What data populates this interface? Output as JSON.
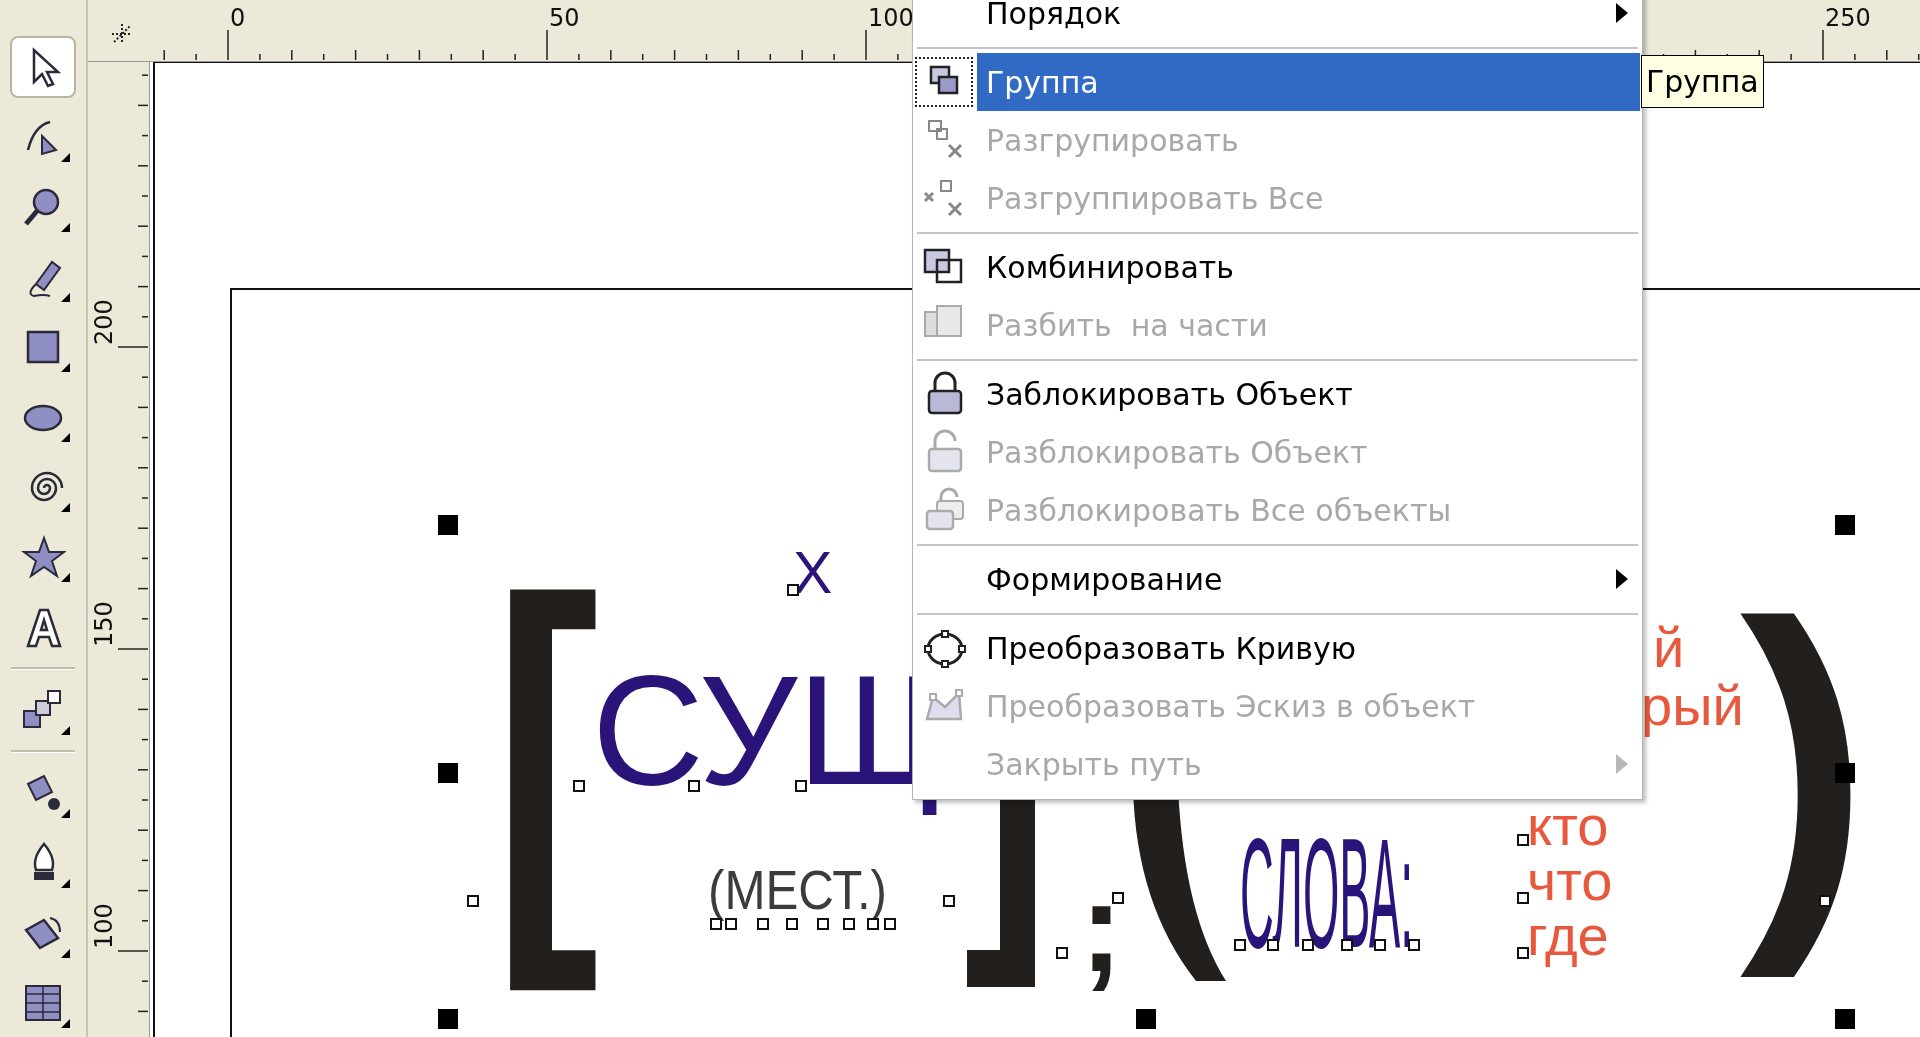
{
  "toolbox": {
    "groups": [
      [
        {
          "kind": "pick",
          "selected": true,
          "flyout": false
        },
        {
          "kind": "shape",
          "selected": false,
          "flyout": true
        },
        {
          "kind": "zoom",
          "selected": false,
          "flyout": true
        },
        {
          "kind": "freehand",
          "selected": false,
          "flyout": true
        },
        {
          "kind": "rectangle",
          "selected": false,
          "flyout": true
        },
        {
          "kind": "ellipse",
          "selected": false,
          "flyout": true
        },
        {
          "kind": "spiral",
          "selected": false,
          "flyout": true
        },
        {
          "kind": "star",
          "selected": false,
          "flyout": true
        },
        {
          "kind": "text",
          "selected": false,
          "flyout": false
        }
      ],
      [
        {
          "kind": "blend",
          "selected": false,
          "flyout": true
        }
      ],
      [
        {
          "kind": "eyedropper",
          "selected": false,
          "flyout": true
        },
        {
          "kind": "outline",
          "selected": false,
          "flyout": true
        },
        {
          "kind": "fill",
          "selected": false,
          "flyout": true
        },
        {
          "kind": "interactive",
          "selected": false,
          "flyout": true
        }
      ]
    ]
  },
  "rulers": {
    "horizontal": [
      "0",
      "50",
      "100",
      "250"
    ],
    "vertical": [
      "200",
      "150",
      "100"
    ]
  },
  "canvas": {
    "texts": [
      {
        "text": "X",
        "color": "#2b1479"
      },
      {
        "text": "[",
        "color": "#221f1c"
      },
      {
        "text": "СУЩ",
        "color": "#2b1479"
      },
      {
        "text": "(МЕСТ.)",
        "color": "#3c3c3c"
      },
      {
        "text": ";",
        "color": "#221f1c"
      },
      {
        "text": "СЛОВА:",
        "color": "#2b1479"
      },
      {
        "text": "й",
        "color": "#e8583c"
      },
      {
        "text": "рый",
        "color": "#e8583c"
      },
      {
        "text": "кто",
        "color": "#e8583c"
      },
      {
        "text": "что",
        "color": "#e8583c"
      },
      {
        "text": "где",
        "color": "#e8583c"
      },
      {
        "text": ")",
        "color": "#221f1c"
      }
    ]
  },
  "context_menu": {
    "sections": [
      [
        {
          "label": "Порядок",
          "disabled": false,
          "selected": false,
          "submenu": true
        }
      ],
      [
        {
          "label": "Группа",
          "kind": "group",
          "disabled": false,
          "selected": true,
          "submenu": false
        },
        {
          "label": "Разгрупировать",
          "kind": "ungroup",
          "disabled": true,
          "selected": false,
          "submenu": false
        },
        {
          "label": "Разгруппировать Все",
          "kind": "ungroup-all",
          "disabled": true,
          "selected": false,
          "submenu": false
        }
      ],
      [
        {
          "label": "Комбинировать",
          "kind": "combine",
          "disabled": false,
          "selected": false,
          "submenu": false
        },
        {
          "label": "Разбить  на части",
          "kind": "break-apart",
          "disabled": true,
          "selected": false,
          "submenu": false
        }
      ],
      [
        {
          "label": "Заблокировать Объект",
          "kind": "lock",
          "disabled": false,
          "selected": false,
          "submenu": false
        },
        {
          "label": "Разблокировать Объект",
          "kind": "unlock",
          "disabled": true,
          "selected": false,
          "submenu": false
        },
        {
          "label": "Разблокировать Все объекты",
          "kind": "unlock-all",
          "disabled": true,
          "selected": false,
          "submenu": false
        }
      ],
      [
        {
          "label": "Формирование",
          "disabled": false,
          "selected": false,
          "submenu": true
        }
      ],
      [
        {
          "label": "Преобразовать Кривую",
          "kind": "curve",
          "disabled": false,
          "selected": false,
          "submenu": false
        },
        {
          "label": "Преобразовать Эскиз в объект",
          "kind": "outline-to-object",
          "disabled": true,
          "selected": false,
          "submenu": false
        },
        {
          "label": "Закрыть путь",
          "disabled": true,
          "selected": false,
          "submenu": true
        }
      ]
    ]
  },
  "tooltip": {
    "text": "Группа"
  }
}
